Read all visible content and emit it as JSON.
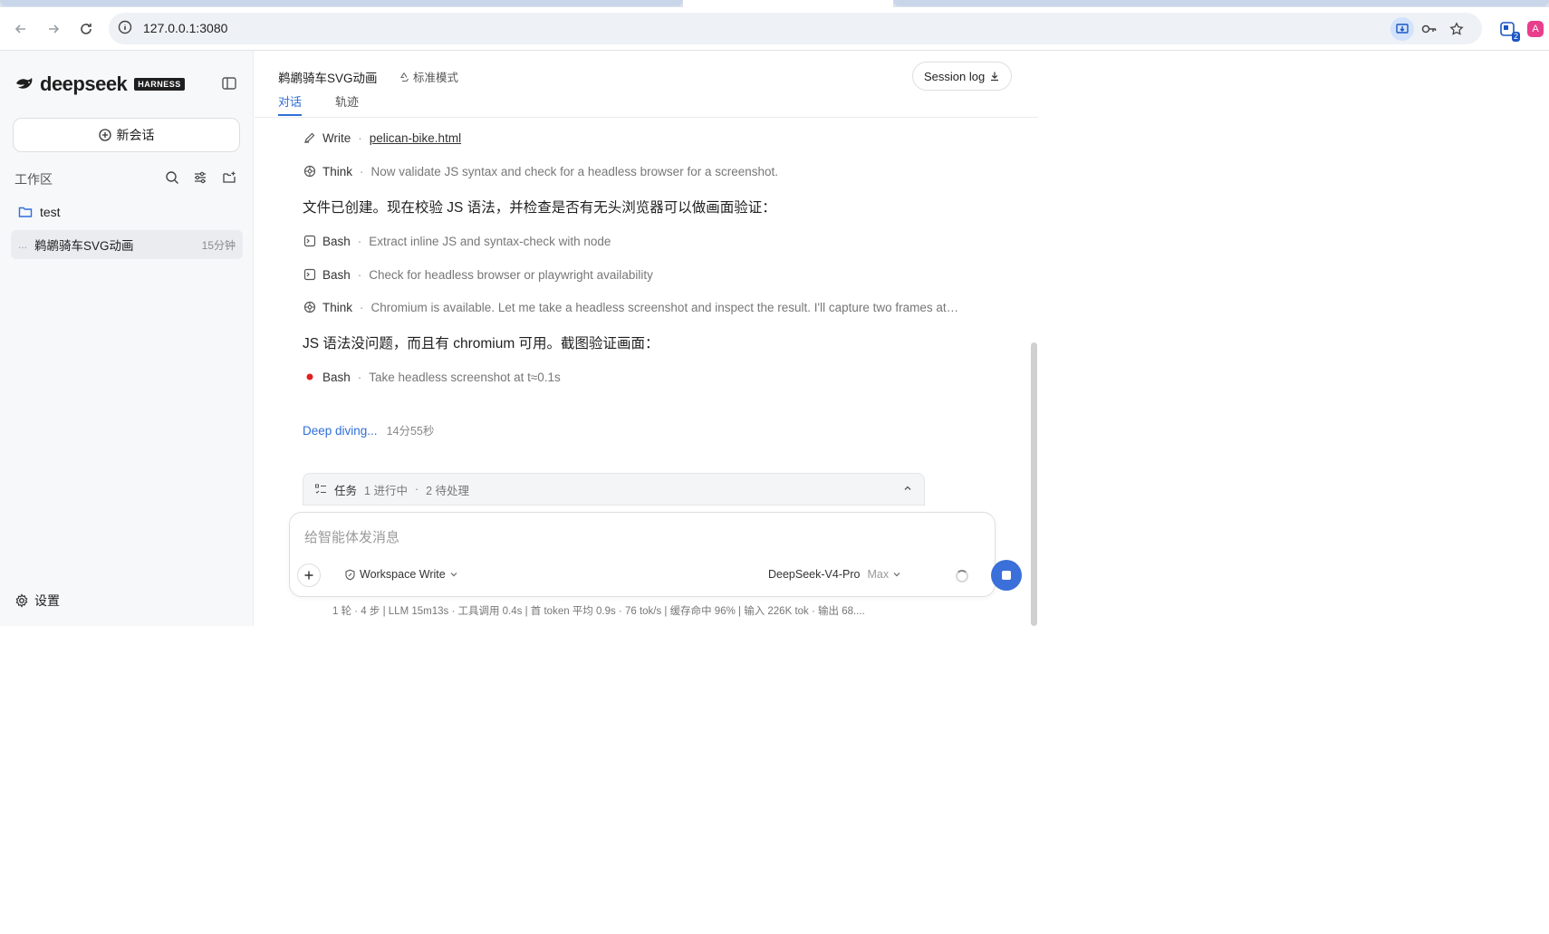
{
  "browser": {
    "url": "127.0.0.1:3080",
    "extension_badge": "2",
    "translate_glyph": "A"
  },
  "sidebar": {
    "logo_text": "deepseek",
    "logo_badge": "HARNESS",
    "new_chat_label": "新会话",
    "workspace_label": "工作区",
    "folder_name": "test",
    "session": {
      "title": "鹈鹕骑车SVG动画",
      "time": "15分钟",
      "indicator": "..."
    },
    "settings_label": "设置"
  },
  "header": {
    "title": "鹈鹕骑车SVG动画",
    "mode": "标准模式",
    "session_log_label": "Session log",
    "tabs": [
      {
        "label": "对话",
        "active": true
      },
      {
        "label": "轨迹",
        "active": false
      }
    ]
  },
  "feed": {
    "steps": [
      {
        "tool": "Write",
        "desc": "pelican-bike.html",
        "icon": "pencil-icon"
      },
      {
        "tool": "Think",
        "desc": "Now validate JS syntax and check for a headless browser for a screenshot.",
        "icon": "brain-icon"
      },
      {
        "tool": "Bash",
        "desc": "Extract inline JS and syntax-check with node",
        "icon": "terminal-icon"
      },
      {
        "tool": "Bash",
        "desc": "Check for headless browser or playwright availability",
        "icon": "terminal-icon"
      },
      {
        "tool": "Think",
        "desc": "Chromium is available. Let me take a headless screenshot and inspect the result. I'll capture two frames at…",
        "icon": "brain-icon"
      },
      {
        "tool": "Bash",
        "desc": "Take headless screenshot at t≈0.1s",
        "icon": "running-dot-icon"
      }
    ],
    "messages": [
      "文件已创建。现在校验 JS 语法，并检查是否有无头浏览器可以做画面验证：",
      "JS 语法没问题，而且有 chromium 可用。截图验证画面："
    ],
    "thinking_label": "Deep diving...",
    "elapsed": "14分55秒"
  },
  "tasks": {
    "label": "任务",
    "in_progress": "1 进行中",
    "separator": "·",
    "pending": "2 待处理"
  },
  "composer": {
    "placeholder": "给智能体发消息",
    "permission": "Workspace Write",
    "model": "DeepSeek-V4-Pro",
    "level": "Max"
  },
  "stats": "1 轮 · 4 步   |   LLM 15m13s · 工具调用 0.4s   |   首 token 平均 0.9s · 76 tok/s   |   缓存命中 96%   |   输入 226K tok · 输出 68....",
  "colors": {
    "accent": "#2f6ed8",
    "stop_button": "#3b6fd9",
    "running_dot": "#e02020"
  }
}
